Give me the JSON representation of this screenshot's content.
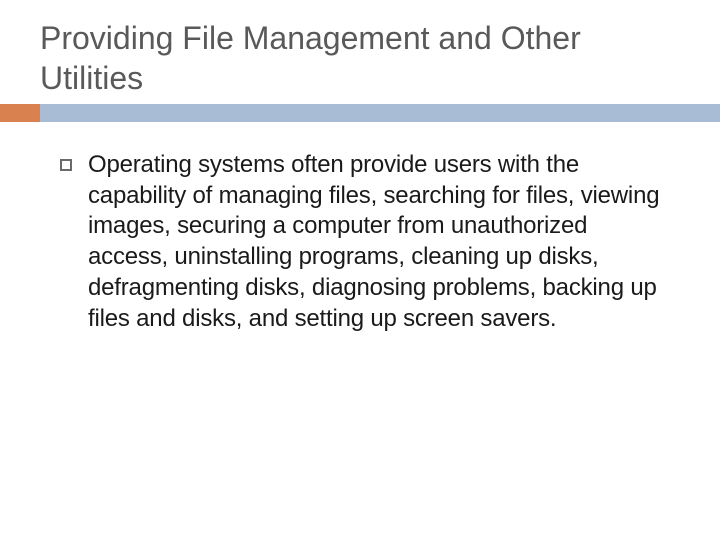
{
  "slide": {
    "title": "Providing File Management and Other Utilities",
    "body": "Operating systems often provide users with the capability of managing files, searching for files, viewing images, securing a computer from unauthorized access, uninstalling programs, cleaning up disks, defragmenting disks, diagnosing problems, backing up files and disks, and setting up screen savers."
  }
}
